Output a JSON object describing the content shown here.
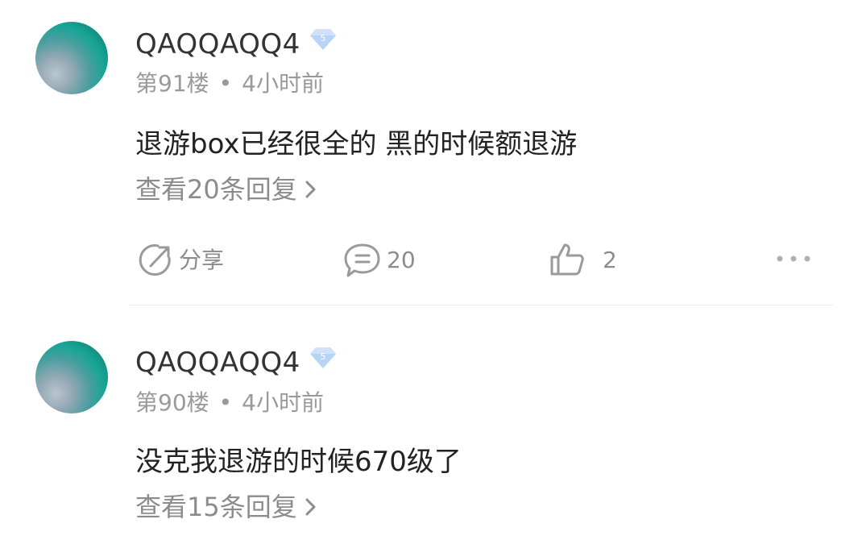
{
  "posts": [
    {
      "username": "QAQQAQQ4",
      "level": "5",
      "floor": "第91楼",
      "time": "4小时前",
      "content": "退游box已经很全的 黑的时候额退游",
      "replies_label": "查看20条回复",
      "share_label": "分享",
      "comment_count": "20",
      "like_count": "2"
    },
    {
      "username": "QAQQAQQ4",
      "level": "5",
      "floor": "第90楼",
      "time": "4小时前",
      "content": "没克我退游的时候670级了",
      "replies_label": "查看15条回复"
    }
  ],
  "meta_separator": "•",
  "colors": {
    "badge": "#b7d3f6",
    "text_secondary": "#8c8c8c",
    "divider": "#ececec"
  },
  "icons": [
    "share-icon",
    "comment-icon",
    "thumbs-up-icon",
    "more-icon",
    "chevron-right-icon",
    "level-badge-icon"
  ]
}
